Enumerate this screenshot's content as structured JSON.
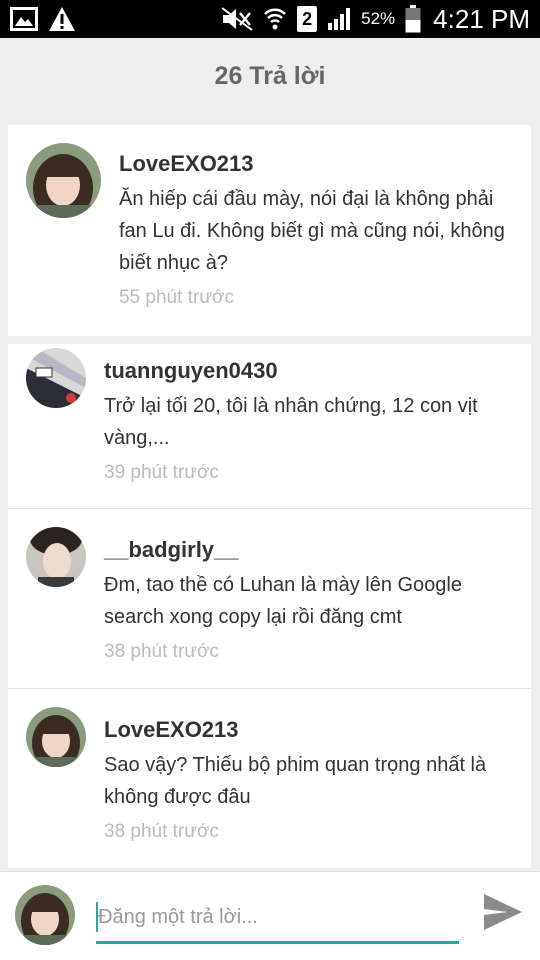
{
  "status_bar": {
    "battery_percent": "52%",
    "time": "4:21 PM",
    "sim_slot": "2",
    "icons": [
      "image-icon",
      "warning-icon",
      "mute-icon",
      "wifi-icon",
      "sim-icon",
      "signal-icon",
      "battery-icon"
    ]
  },
  "header": {
    "title": "26 Trả lời"
  },
  "comments": [
    {
      "username": "LoveEXO213",
      "message": "Ăn hiếp cái đầu mày, nói đại là không phải fan Lu đi. Không biết gì mà cũng nói, không biết nhục à?",
      "time": "55 phút trước",
      "avatar": "user-avatar"
    },
    {
      "username": "tuannguyen0430",
      "message": "Trở lại tối 20, tôi là nhân chứng, 12 con vịt vàng,...",
      "time": "39 phút trước",
      "avatar": "user-avatar"
    },
    {
      "username": "__badgirly__",
      "message": "Đm, tao thề có Luhan là mày lên Google search xong copy lại rồi đăng cmt",
      "time": "38 phút trước",
      "avatar": "user-avatar"
    },
    {
      "username": "LoveEXO213",
      "message": "Sao vậy? Thiếu bộ phim quan trọng nhất là không được đâu",
      "time": "38 phút trước",
      "avatar": "user-avatar"
    }
  ],
  "reply": {
    "placeholder": "Đăng một trả lời...",
    "value": ""
  },
  "colors": {
    "accent": "#2aa8a8",
    "background": "#eeeeee",
    "card": "#ffffff",
    "muted_text": "#bbbbbb"
  }
}
